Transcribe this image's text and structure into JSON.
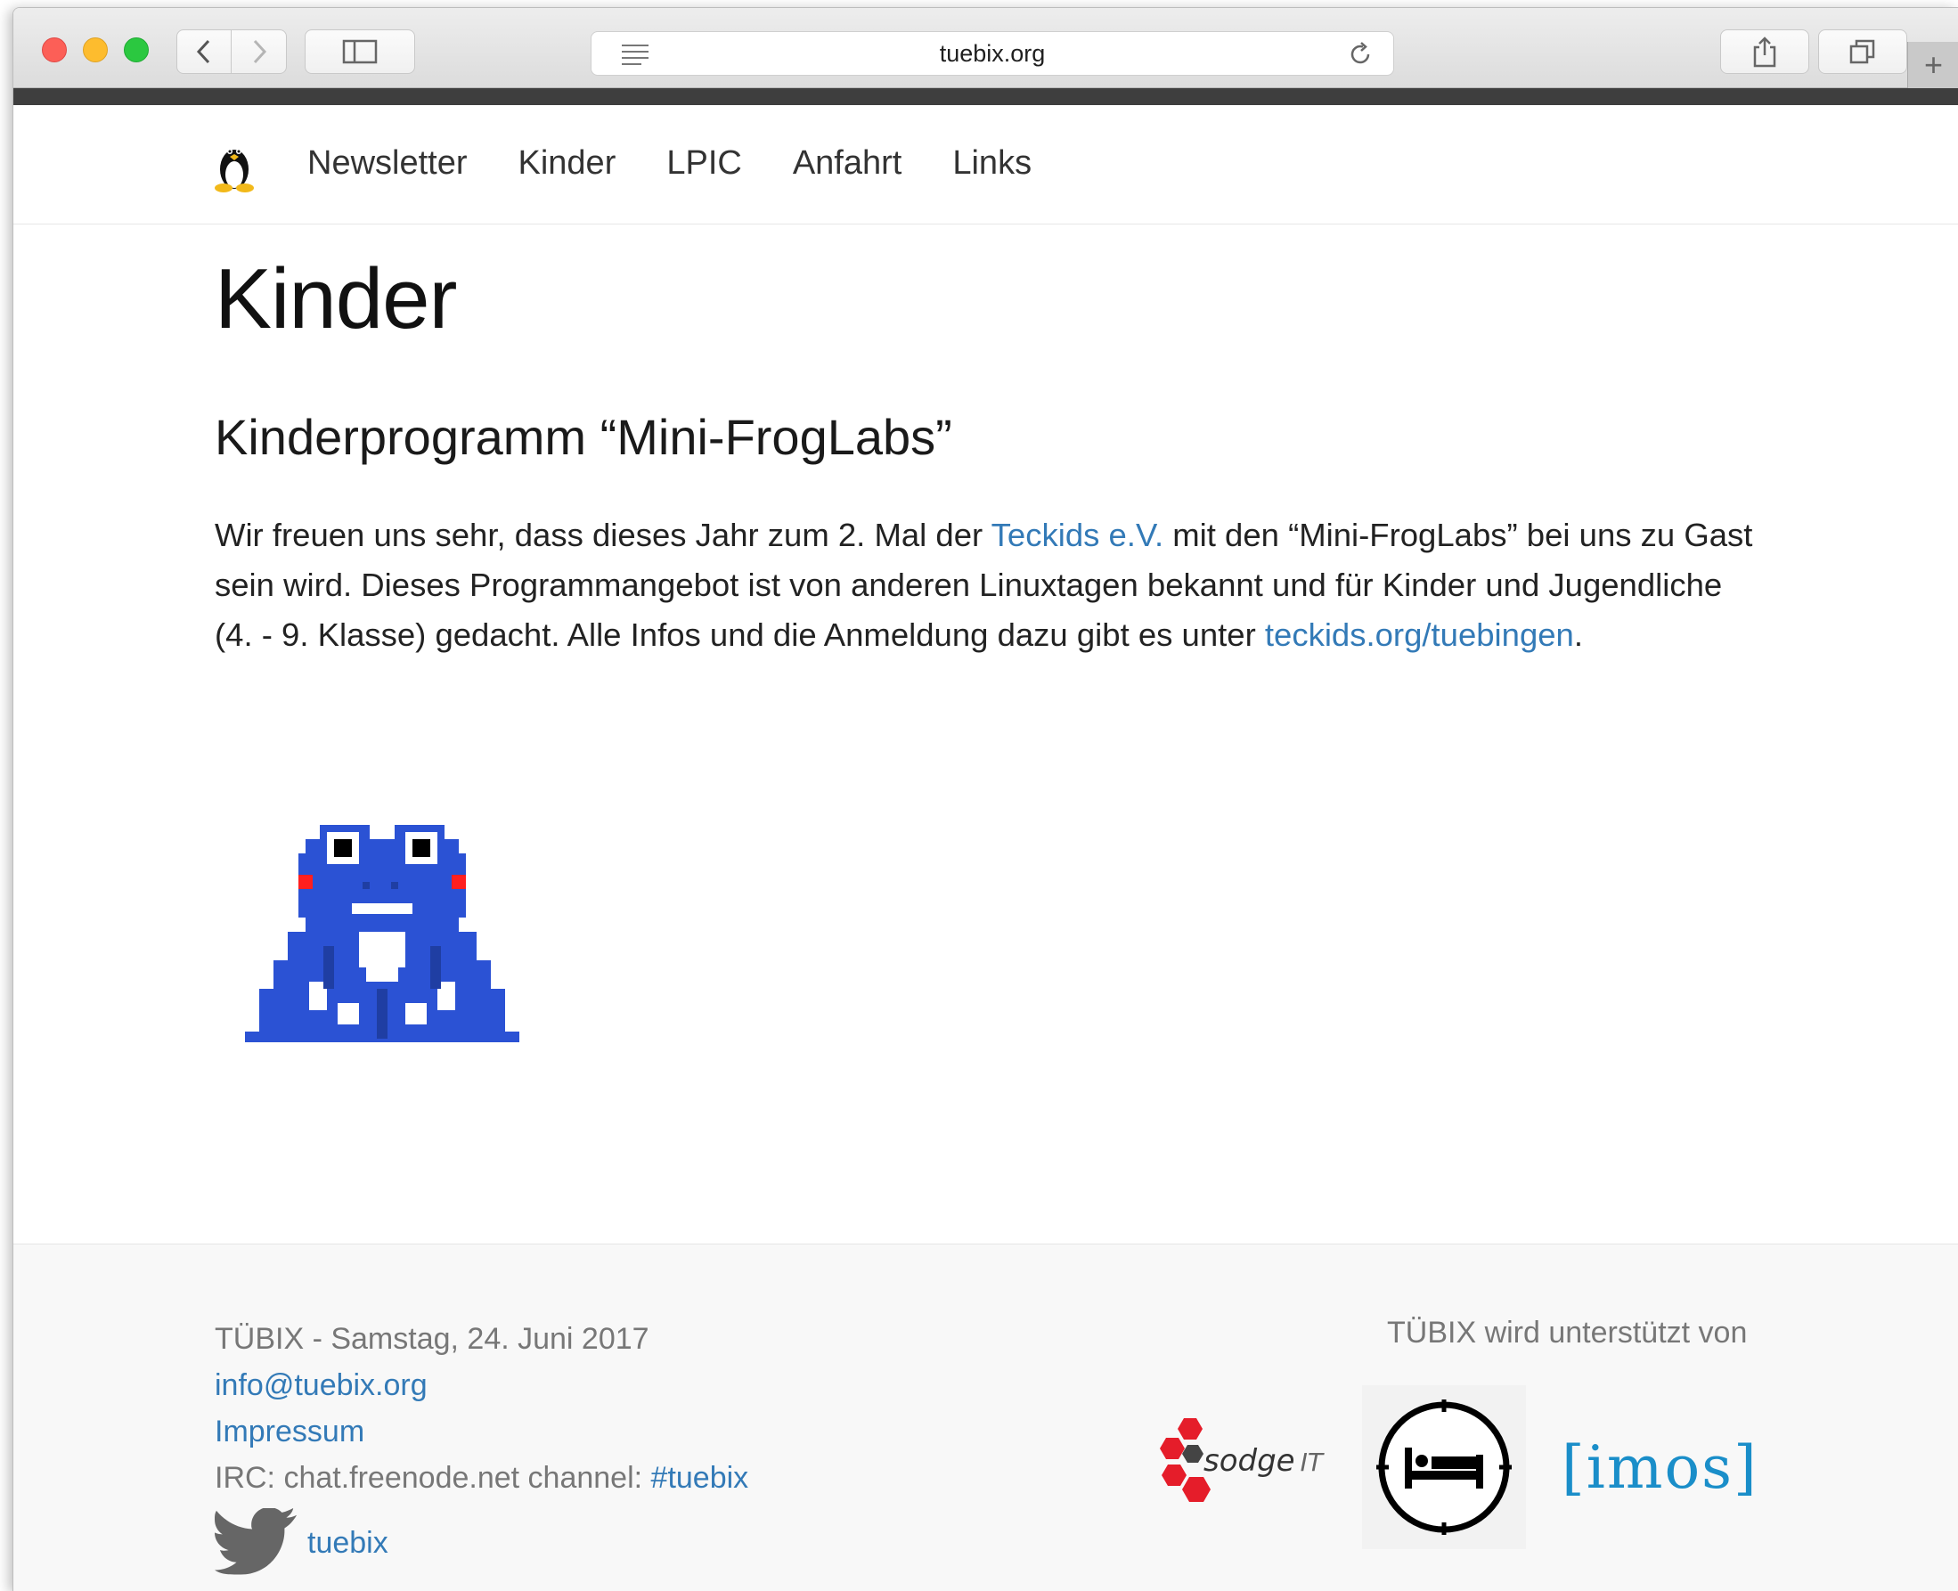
{
  "browser": {
    "url": "tuebix.org"
  },
  "nav": {
    "items": [
      "Newsletter",
      "Kinder",
      "LPIC",
      "Anfahrt",
      "Links"
    ]
  },
  "main": {
    "title": "Kinder",
    "subtitle": "Kinderprogramm “Mini-FrogLabs”",
    "para_1": "Wir freuen uns sehr, dass dieses Jahr zum 2. Mal der ",
    "link_teckids": "Teckids e.V.",
    "para_2": " mit den “Mini-FrogLabs” bei uns zu Gast sein wird. Dieses Programmangebot ist von anderen Linuxtagen bekannt und für Kinder und Jugendliche (4. - 9. Klasse) gedacht. Alle Infos und die Anmeldung dazu gibt es unter ",
    "link_teckids_url": "teckids.org/tuebingen",
    "para_end": "."
  },
  "footer": {
    "event": "TÜBIX - Samstag, 24. Juni 2017",
    "email": "info@tuebix.org",
    "impressum": "Impressum",
    "irc_prefix": "IRC: chat.freenode.net channel: ",
    "irc_channel": "#tuebix",
    "twitter": "tuebix",
    "sponsors_title": "TÜBIX wird unterstützt von",
    "sponsor_sodge": "sodge",
    "sponsor_sodge_it": "IT",
    "sponsor_imos": "[imos]"
  },
  "colors": {
    "link": "#337ab7",
    "frog_blue": "#2b52d4",
    "imos": "#1a8ec9"
  }
}
